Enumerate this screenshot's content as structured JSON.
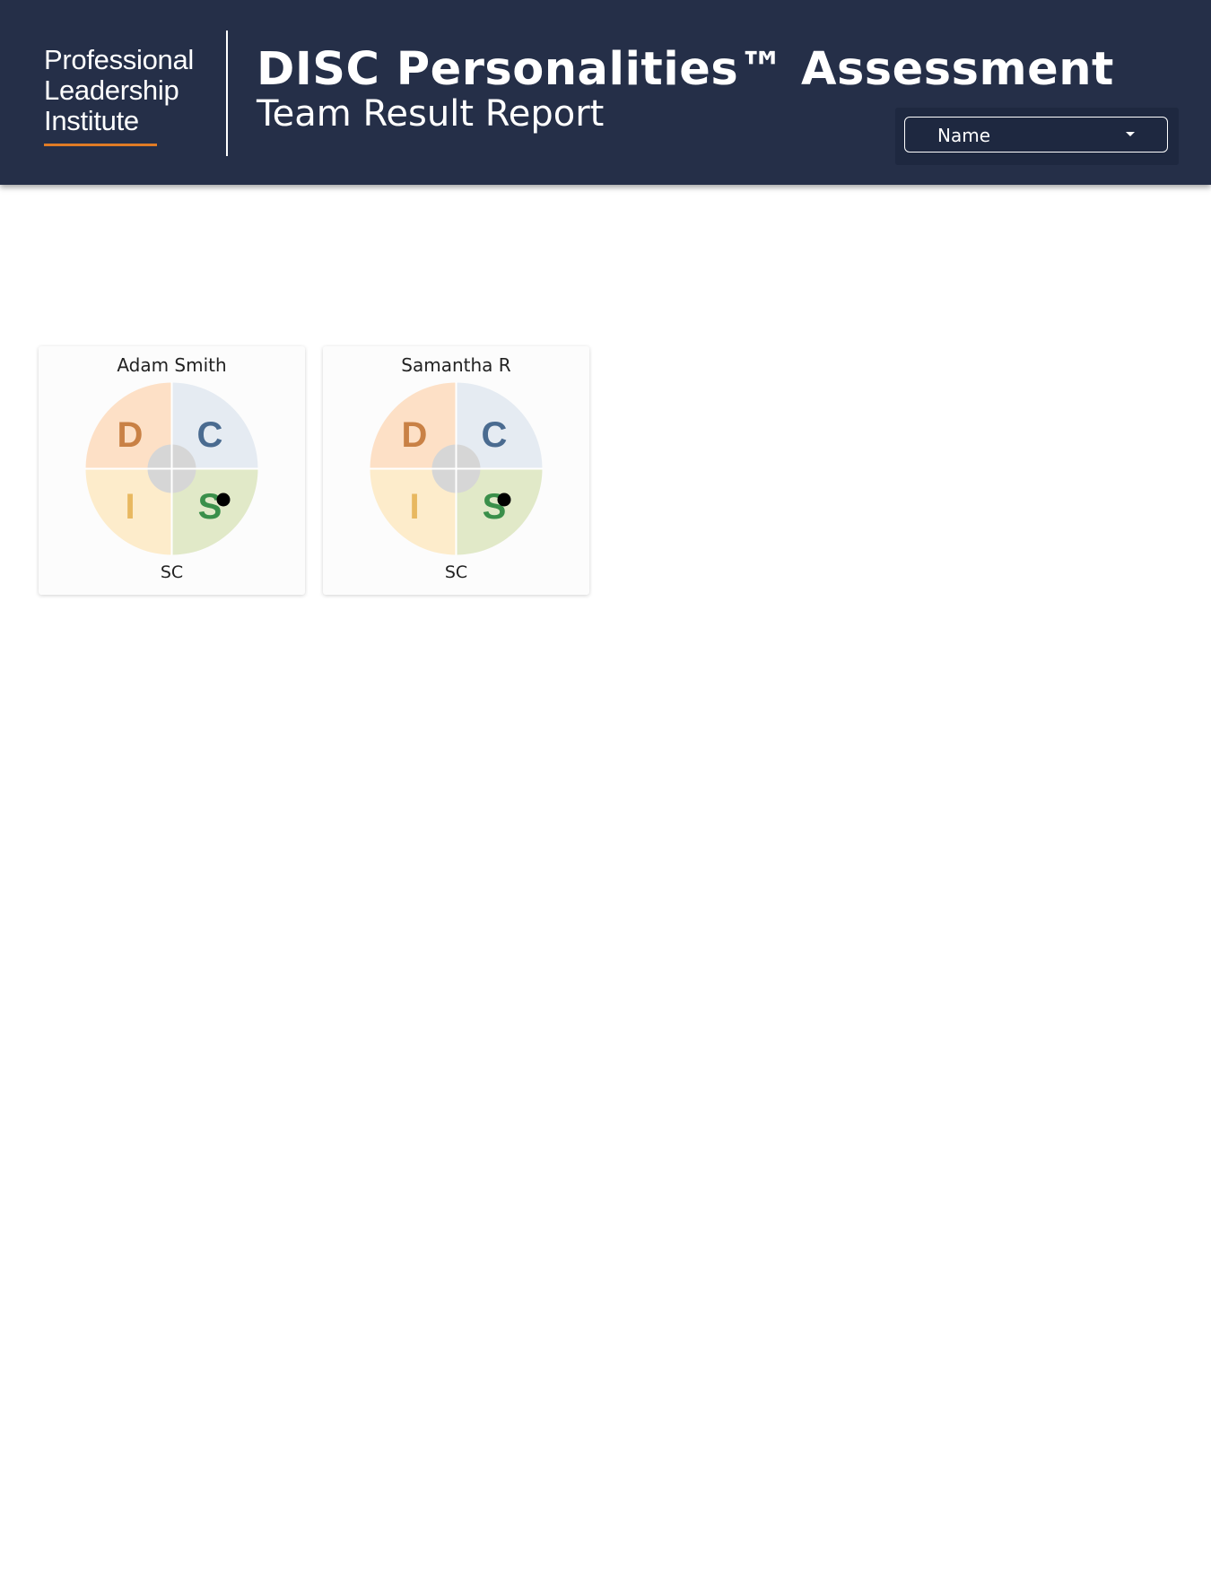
{
  "header": {
    "logo_lines": [
      "Professional",
      "Leadership",
      "Institute"
    ],
    "title": "DISC Personalities™ Assessment",
    "subtitle": "Team Result Report",
    "sort_select": {
      "value": "Name"
    }
  },
  "colors": {
    "header_bg": "#252f48",
    "logo_accent": "#e07b25",
    "quadrant_d": "#fde0c6",
    "quadrant_c": "#e5ebf2",
    "quadrant_i": "#fdeccb",
    "quadrant_s": "#e1e9c8",
    "letter_d": "#c98145",
    "letter_c": "#4a6b90",
    "letter_i": "#e8b860",
    "letter_s": "#3a8f4a"
  },
  "disc_letters": {
    "d": "D",
    "c": "C",
    "i": "I",
    "s": "S"
  },
  "team": [
    {
      "name": "Adam Smith",
      "type": "SC"
    },
    {
      "name": "Samantha R",
      "type": "SC"
    }
  ]
}
